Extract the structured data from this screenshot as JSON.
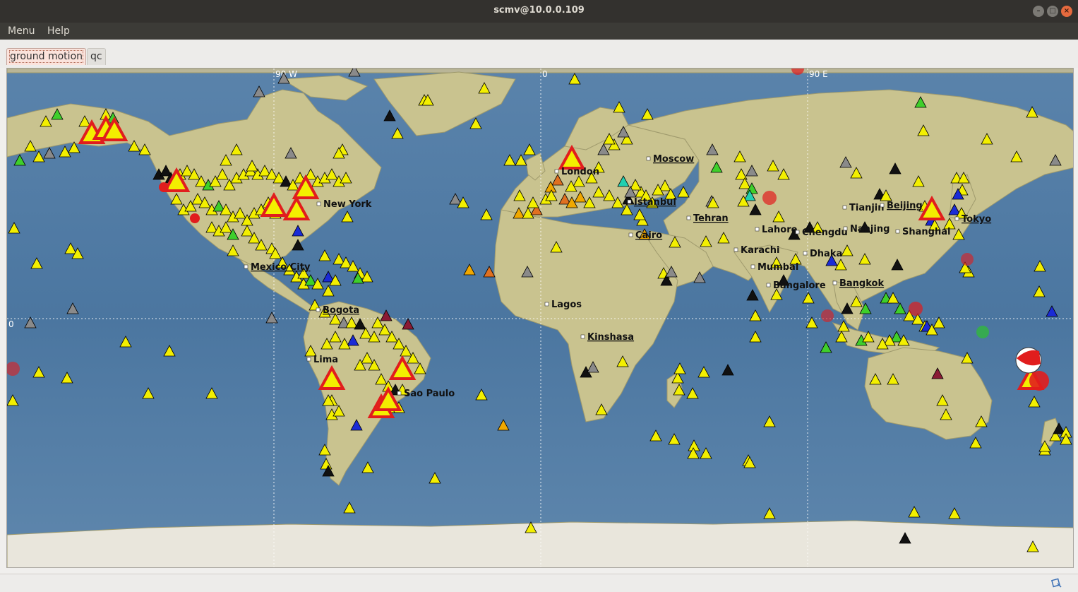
{
  "window": {
    "title": "scmv@10.0.0.109",
    "controls": [
      "minimize",
      "maximize",
      "close"
    ]
  },
  "menu": {
    "items": [
      "Menu",
      "Help"
    ]
  },
  "tabs": [
    {
      "label": "ground motion",
      "active": true
    },
    {
      "label": "qc",
      "active": false
    }
  ],
  "map": {
    "grid_labels": {
      "lon_west": "90 W",
      "lon_zero": "0",
      "lon_east": "90 E",
      "lat_zero": "0"
    },
    "cities": [
      "New York",
      "Mexico City",
      "Bogota",
      "Lima",
      "Sao Paulo",
      "Moscow",
      "London",
      "Istanbul",
      "Cairo",
      "Tehran",
      "Lagos",
      "Kinshasa",
      "Karachi",
      "Lahore",
      "Mumbai",
      "Bangalore",
      "Chengdu",
      "Dhaka",
      "Tianjin",
      "Beijing",
      "Nanjing",
      "Shanghai",
      "Tokyo",
      "Bangkok"
    ],
    "colors": {
      "ocean": "#4f7aa3",
      "land": "#c9c38f",
      "ice": "#e9e6dc",
      "graticule": "#ffffff",
      "station_ok": "#f3ef00",
      "station_alert": "#e11d1d"
    }
  },
  "status": {
    "icon": "network-status-icon"
  }
}
